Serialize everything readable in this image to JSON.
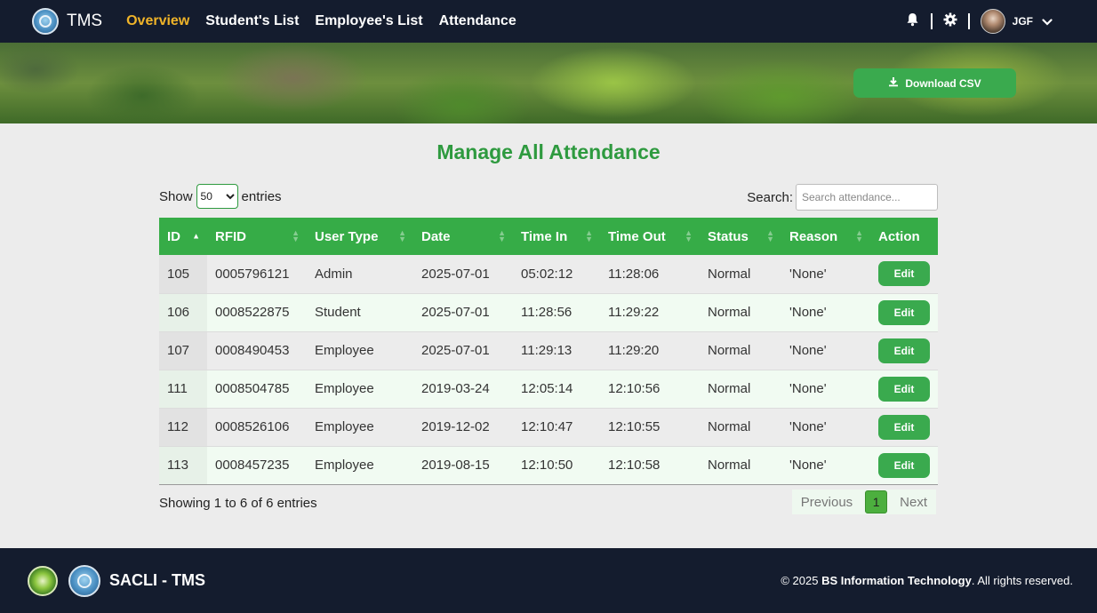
{
  "navbar": {
    "brand": "TMS",
    "links": [
      {
        "label": "Overview",
        "active": true
      },
      {
        "label": "Student's List",
        "active": false
      },
      {
        "label": "Employee's List",
        "active": false
      },
      {
        "label": "Attendance",
        "active": false
      }
    ],
    "icons": [
      "bell-icon",
      "gear-icon"
    ],
    "user": "JGF"
  },
  "banner": {
    "download_label": "Download CSV"
  },
  "main": {
    "title": "Manage All Attendance",
    "show_label": "Show",
    "entries_value": "50",
    "entries_label": "entries",
    "search_label": "Search:",
    "search_placeholder": "Search attendance..."
  },
  "table": {
    "columns": [
      "ID",
      "RFID",
      "User Type",
      "Date",
      "Time In",
      "Time Out",
      "Status",
      "Reason",
      "Action"
    ],
    "rows": [
      [
        "105",
        "0005796121",
        "Admin",
        "2025-07-01",
        "05:02:12",
        "11:28:06",
        "Normal",
        "'None'",
        "Edit"
      ],
      [
        "106",
        "0008522875",
        "Student",
        "2025-07-01",
        "11:28:56",
        "11:29:22",
        "Normal",
        "'None'",
        "Edit"
      ],
      [
        "107",
        "0008490453",
        "Employee",
        "2025-07-01",
        "11:29:13",
        "11:29:20",
        "Normal",
        "'None'",
        "Edit"
      ],
      [
        "111",
        "0008504785",
        "Employee",
        "2019-03-24",
        "12:05:14",
        "12:10:56",
        "Normal",
        "'None'",
        "Edit"
      ],
      [
        "112",
        "0008526106",
        "Employee",
        "2019-12-02",
        "12:10:47",
        "12:10:55",
        "Normal",
        "'None'",
        "Edit"
      ],
      [
        "113",
        "0008457235",
        "Employee",
        "2019-08-15",
        "12:10:50",
        "12:10:58",
        "Normal",
        "'None'",
        "Edit"
      ]
    ]
  },
  "pagination": {
    "info": "Showing 1 to 6 of 6 entries",
    "previous": "Previous",
    "current": "1",
    "next": "Next"
  },
  "footer": {
    "title": "SACLI - TMS",
    "copyright_prefix": "© 2025",
    "copyright_org": "BS Information Technology",
    "copyright_suffix": ". All rights reserved."
  },
  "colors": {
    "navbar": "#141c2e",
    "accent_green": "#36ac47",
    "active_link": "#f0b429"
  }
}
